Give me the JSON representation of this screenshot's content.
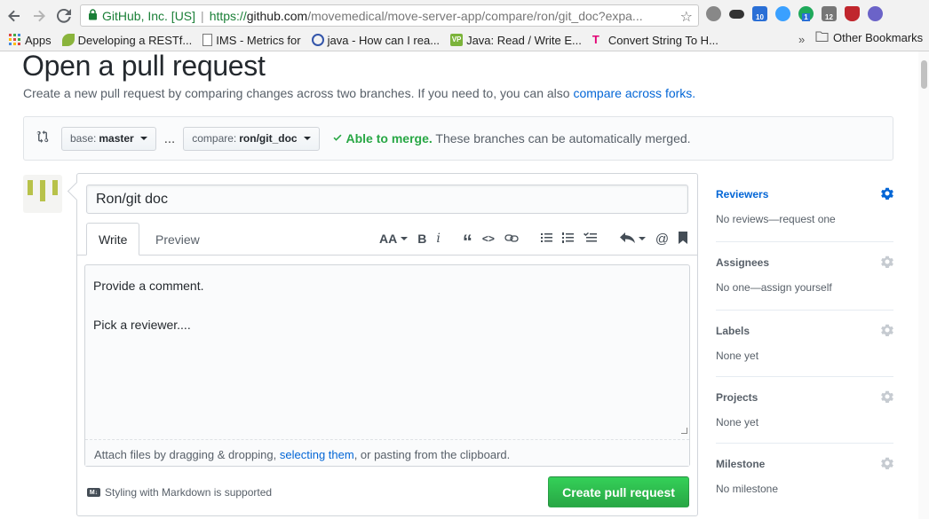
{
  "browser": {
    "ev_label": "GitHub, Inc. [US]",
    "url_scheme": "https://",
    "url_host": "github.com",
    "url_path": "/movemedical/move-server-app/compare/ron/git_doc?expa...",
    "extension_badges": [
      "10",
      "1",
      "12"
    ],
    "bookmarks": [
      {
        "label": "Apps",
        "icon": "apps-grid-icon"
      },
      {
        "label": "Developing a RESTf...",
        "icon": "leaf-icon"
      },
      {
        "label": "IMS - Metrics for",
        "icon": "page-icon"
      },
      {
        "label": "java - How can I rea...",
        "icon": "globe-icon"
      },
      {
        "label": "Java: Read / Write E...",
        "icon": "vp-icon"
      },
      {
        "label": "Convert String To H...",
        "icon": "tmobile-icon"
      }
    ],
    "other_bookmarks": "Other Bookmarks"
  },
  "page": {
    "title": "Open a pull request",
    "subtitle_text": "Create a new pull request by comparing changes across two branches. If you need to, you can also ",
    "subtitle_link": "compare across forks."
  },
  "compare": {
    "base_label": "base:",
    "base_value": "master",
    "dots": "...",
    "compare_label": "compare:",
    "compare_value": "ron/git_doc",
    "merge_status": "Able to merge.",
    "merge_detail": "These branches can be automatically merged."
  },
  "composer": {
    "title_value": "Ron/git doc",
    "tab_write": "Write",
    "tab_preview": "Preview",
    "toolbar": {
      "heading": "AA",
      "bold": "B",
      "italic": "i",
      "quote": "“",
      "code": "<>",
      "mention": "@"
    },
    "body_value": "Provide a comment.\n\nPick a reviewer....",
    "attach_pre": "Attach files by dragging & dropping, ",
    "attach_link": "selecting them",
    "attach_post": ", or pasting from the clipboard.",
    "markdown_badge": "M↓",
    "markdown_note": "Styling with Markdown is supported",
    "create_button": "Create pull request"
  },
  "sidebar": {
    "reviewers_title": "Reviewers",
    "reviewers_value": "No reviews—request one",
    "assignees_title": "Assignees",
    "assignees_value": "No one—assign yourself",
    "labels_title": "Labels",
    "labels_value": "None yet",
    "projects_title": "Projects",
    "projects_value": "None yet",
    "milestone_title": "Milestone",
    "milestone_value": "No milestone"
  },
  "colors": {
    "link": "#0366d6",
    "success": "#28a745",
    "avatar_bars": "#b8c24a"
  }
}
